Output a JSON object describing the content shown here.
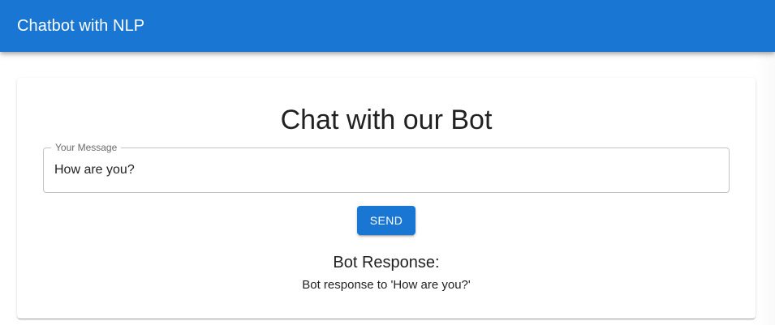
{
  "appbar": {
    "title": "Chatbot with NLP",
    "color": "#1976d2"
  },
  "chat": {
    "heading": "Chat with our Bot",
    "message_label": "Your Message",
    "message_value": "How are you?",
    "send_label": "SEND",
    "response_heading": "Bot Response:",
    "response_text": "Bot response to 'How are you?'"
  }
}
